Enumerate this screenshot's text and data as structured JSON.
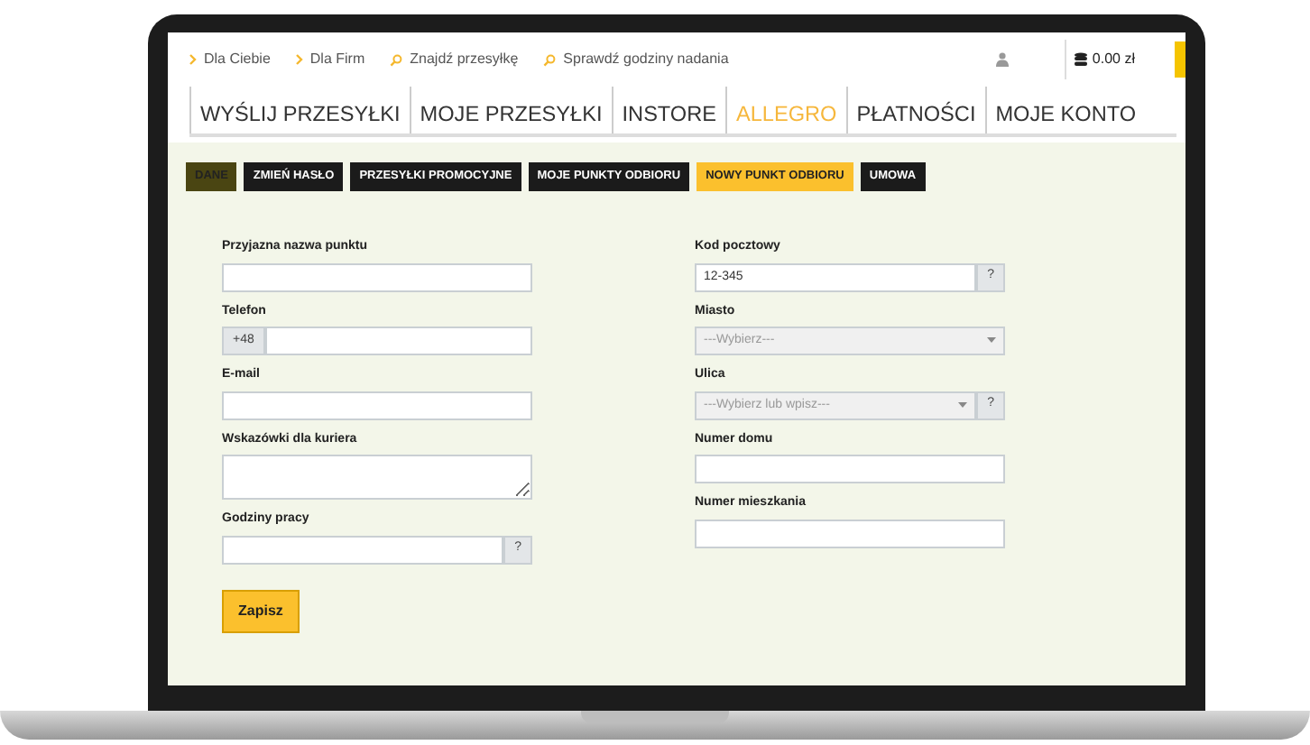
{
  "top_links": [
    {
      "kind": "chevron",
      "label": "Dla Ciebie"
    },
    {
      "kind": "chevron",
      "label": "Dla Firm"
    },
    {
      "kind": "search",
      "label": "Znajdź przesyłkę"
    },
    {
      "kind": "search",
      "label": "Sprawdź godziny nadania"
    }
  ],
  "balance": "0.00 zł",
  "nav": [
    {
      "label": "WYŚLIJ PRZESYŁKI",
      "selected": false
    },
    {
      "label": "MOJE PRZESYŁKI",
      "selected": false
    },
    {
      "label": "INSTORE",
      "selected": false
    },
    {
      "label": "ALLEGRO",
      "selected": true
    },
    {
      "label": "PŁATNOŚCI",
      "selected": false
    },
    {
      "label": "MOJE KONTO",
      "selected": false
    }
  ],
  "subtabs": [
    {
      "label": "DANE",
      "selected": false,
      "highlighted": true
    },
    {
      "label": "ZMIEŃ HASŁO",
      "selected": false,
      "highlighted": false
    },
    {
      "label": "PRZESYŁKI PROMOCYJNE",
      "selected": false,
      "highlighted": false
    },
    {
      "label": "MOJE PUNKTY ODBIORU",
      "selected": false,
      "highlighted": false
    },
    {
      "label": "NOWY PUNKT ODBIORU",
      "selected": true,
      "highlighted": false
    },
    {
      "label": "UMOWA",
      "selected": false,
      "highlighted": false
    }
  ],
  "form_left": [
    {
      "kind": "text",
      "label": "Przyjazna nazwa punktu"
    },
    {
      "kind": "phone",
      "label": "Telefon",
      "prefix": "+48"
    },
    {
      "kind": "text",
      "label": "E-mail"
    },
    {
      "kind": "textarea",
      "label": "Wskazówki dla kuriera"
    },
    {
      "kind": "help",
      "label": "Godziny pracy",
      "help": "?"
    }
  ],
  "form_right": [
    {
      "kind": "help",
      "label": "Kod pocztowy",
      "value": "12-345",
      "help": "?"
    },
    {
      "kind": "select",
      "label": "Miasto",
      "placeholder": "---Wybierz---",
      "disabled": true
    },
    {
      "kind": "select-help",
      "label": "Ulica",
      "placeholder": "---Wybierz lub wpisz---",
      "disabled": true,
      "help": "?"
    },
    {
      "kind": "text",
      "label": "Numer domu"
    },
    {
      "kind": "text",
      "label": "Numer mieszkania"
    }
  ],
  "save_button": "Zapisz"
}
